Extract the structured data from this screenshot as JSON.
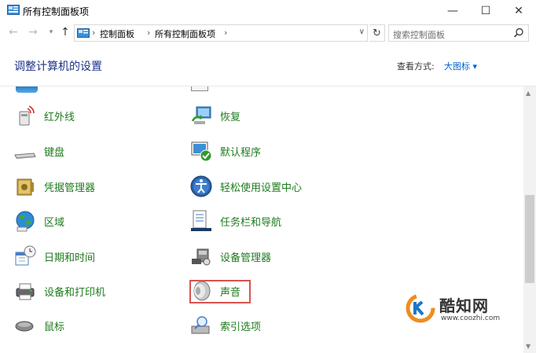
{
  "window": {
    "title": "所有控制面板项",
    "min_glyph": "—",
    "max_glyph": "☐",
    "close_glyph": "✕"
  },
  "nav": {
    "back_glyph": "←",
    "forward_glyph": "→",
    "recent_glyph": "▾",
    "up_glyph": "↑",
    "crumbs": [
      "控制面板",
      "所有控制面板项"
    ],
    "sep_glyph": "›",
    "dropdown_glyph": "∨",
    "refresh_glyph": "↻",
    "search_placeholder": "搜索控制面板"
  },
  "header": {
    "heading": "调整计算机的设置",
    "view_by_label": "查看方式:",
    "view_by_value": "大图标 ▾"
  },
  "items": {
    "left": [
      {
        "label": "红外线",
        "icon": "infrared-icon"
      },
      {
        "label": "键盘",
        "icon": "keyboard-icon"
      },
      {
        "label": "凭据管理器",
        "icon": "credential-manager-icon"
      },
      {
        "label": "区域",
        "icon": "region-globe-icon"
      },
      {
        "label": "日期和时间",
        "icon": "date-time-icon"
      },
      {
        "label": "设备和打印机",
        "icon": "printer-icon"
      },
      {
        "label": "鼠标",
        "icon": "mouse-icon"
      }
    ],
    "right": [
      {
        "label": "恢复",
        "icon": "recovery-icon"
      },
      {
        "label": "默认程序",
        "icon": "default-programs-icon"
      },
      {
        "label": "轻松使用设置中心",
        "icon": "ease-of-access-icon"
      },
      {
        "label": "任务栏和导航",
        "icon": "taskbar-icon"
      },
      {
        "label": "设备管理器",
        "icon": "device-manager-icon"
      },
      {
        "label": "声音",
        "icon": "sound-speaker-icon"
      },
      {
        "label": "索引选项",
        "icon": "indexing-icon"
      }
    ],
    "highlighted": "声音"
  },
  "scrollbar": {
    "up_glyph": "▲",
    "down_glyph": "▼"
  },
  "watermark": {
    "brand": "酷知网",
    "url": "www.coozhi.com"
  },
  "colors": {
    "link_green": "#1e7b1e",
    "heading_blue": "#1e3287",
    "highlight_red": "#d9534f",
    "accent_blue": "#0066cc"
  }
}
